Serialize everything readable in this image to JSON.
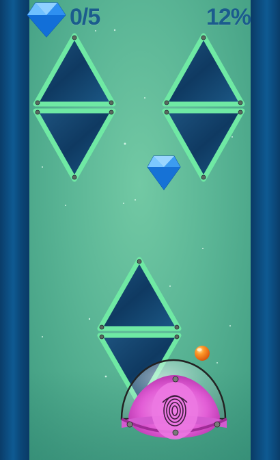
{
  "hud": {
    "gems_collected": "0/5",
    "progress_percent": "12%"
  },
  "level": {
    "progress": 0.12,
    "gems_collected": 0,
    "gems_total": 5
  },
  "icons": {
    "hud_gem": "blue-diamond-icon",
    "player": "fingerprint-pod",
    "ball": "orange-ball"
  },
  "colors": {
    "field": "#5bb696",
    "wall": "#0e5a92",
    "frame": "#6fe9a4",
    "glass": "#123c66",
    "gem": "#1e88e8",
    "pod": "#e060d8",
    "ball": "#ff7a10",
    "hud_text": "#1b5c8d"
  }
}
